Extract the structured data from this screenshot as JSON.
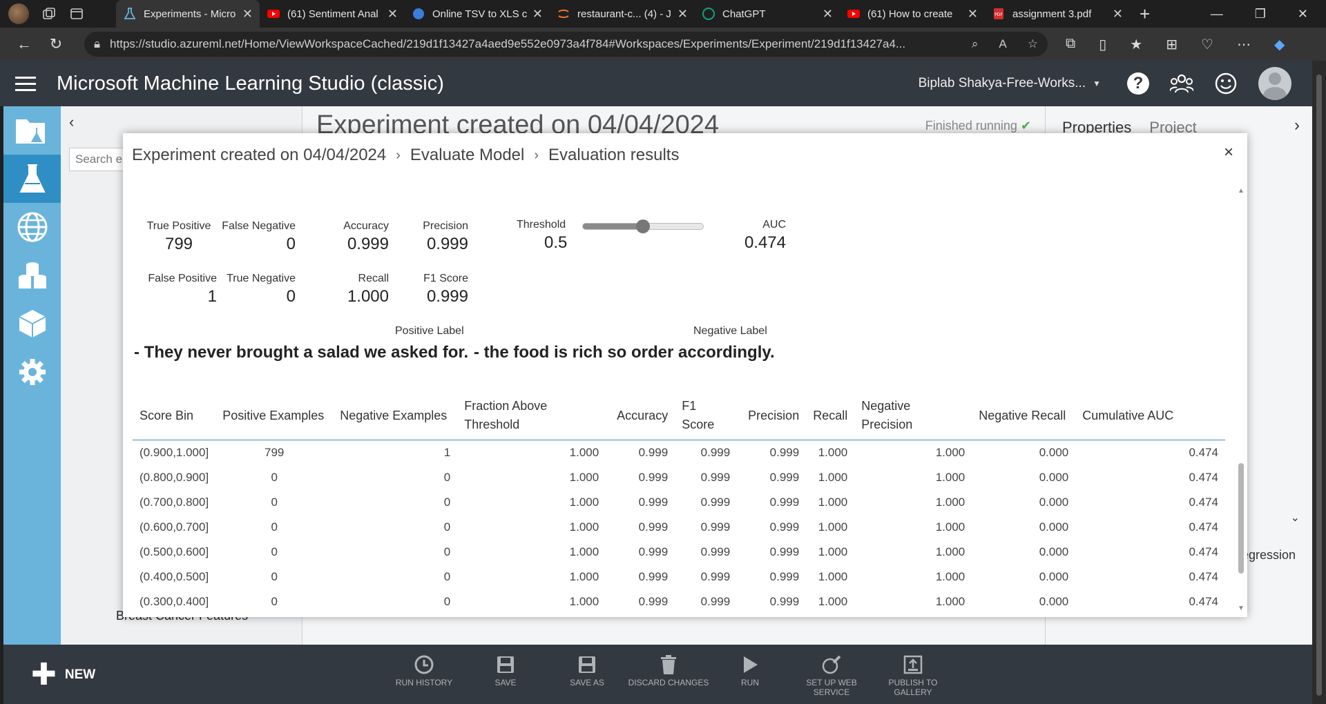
{
  "browser": {
    "tabs": [
      {
        "label": "Experiments - Micro",
        "active": true
      },
      {
        "label": "(61) Sentiment Anal"
      },
      {
        "label": "Online TSV to XLS c"
      },
      {
        "label": "restaurant-c... (4) - J"
      },
      {
        "label": "ChatGPT"
      },
      {
        "label": "(61) How to create"
      },
      {
        "label": "assignment 3.pdf"
      }
    ],
    "url": "https://studio.azureml.net/Home/ViewWorkspaceCached/219d1f13427a4aed9e552e0973a4f784#Workspaces/Experiments/Experiment/219d1f13427a4..."
  },
  "studio": {
    "title": "Microsoft Machine Learning Studio (classic)",
    "workspace": "Biplab Shakya-Free-Works...",
    "help": "?"
  },
  "palette": {
    "search_placeholder": "Search e",
    "bottom_item": "Breast Cancer Features"
  },
  "canvas": {
    "title": "Experiment created on 04/04/2024",
    "status": "Finished running"
  },
  "properties": {
    "tab_properties": "Properties",
    "tab_project": "Project",
    "fragment": "regression"
  },
  "modal": {
    "breadcrumb": [
      "Experiment created on 04/04/2024",
      "Evaluate Model",
      "Evaluation results"
    ],
    "metrics": {
      "true_positive": {
        "label": "True Positive",
        "value": "799"
      },
      "false_negative": {
        "label": "False Negative",
        "value": "0"
      },
      "accuracy": {
        "label": "Accuracy",
        "value": "0.999"
      },
      "precision": {
        "label": "Precision",
        "value": "0.999"
      },
      "false_positive": {
        "label": "False Positive",
        "value": "1"
      },
      "true_negative": {
        "label": "True Negative",
        "value": "0"
      },
      "recall": {
        "label": "Recall",
        "value": "1.000"
      },
      "f1": {
        "label": "F1 Score",
        "value": "0.999"
      },
      "threshold": {
        "label": "Threshold",
        "value": "0.5"
      },
      "auc": {
        "label": "AUC",
        "value": "0.474"
      }
    },
    "threshold_fraction": 0.5,
    "positive_label": {
      "label": "Positive Label",
      "value": "- They never brought a salad we asked for."
    },
    "negative_label": {
      "label": "Negative Label",
      "value": "- the food is rich so order accordingly."
    },
    "table": {
      "headers": [
        "Score Bin",
        "Positive Examples",
        "Negative Examples",
        "Fraction Above Threshold",
        "Accuracy",
        "F1 Score",
        "Precision",
        "Recall",
        "Negative Precision",
        "Negative Recall",
        "Cumulative AUC"
      ],
      "rows": [
        [
          "(0.900,1.000]",
          "799",
          "1",
          "1.000",
          "0.999",
          "0.999",
          "0.999",
          "1.000",
          "1.000",
          "0.000",
          "0.474"
        ],
        [
          "(0.800,0.900]",
          "0",
          "0",
          "1.000",
          "0.999",
          "0.999",
          "0.999",
          "1.000",
          "1.000",
          "0.000",
          "0.474"
        ],
        [
          "(0.700,0.800]",
          "0",
          "0",
          "1.000",
          "0.999",
          "0.999",
          "0.999",
          "1.000",
          "1.000",
          "0.000",
          "0.474"
        ],
        [
          "(0.600,0.700]",
          "0",
          "0",
          "1.000",
          "0.999",
          "0.999",
          "0.999",
          "1.000",
          "1.000",
          "0.000",
          "0.474"
        ],
        [
          "(0.500,0.600]",
          "0",
          "0",
          "1.000",
          "0.999",
          "0.999",
          "0.999",
          "1.000",
          "1.000",
          "0.000",
          "0.474"
        ],
        [
          "(0.400,0.500]",
          "0",
          "0",
          "1.000",
          "0.999",
          "0.999",
          "0.999",
          "1.000",
          "1.000",
          "0.000",
          "0.474"
        ],
        [
          "(0.300,0.400]",
          "0",
          "0",
          "1.000",
          "0.999",
          "0.999",
          "0.999",
          "1.000",
          "1.000",
          "0.000",
          "0.474"
        ]
      ]
    }
  },
  "toolbar": {
    "new_label": "NEW",
    "items": [
      "RUN HISTORY",
      "SAVE",
      "SAVE AS",
      "DISCARD CHANGES",
      "RUN",
      "SET UP WEB SERVICE",
      "PUBLISH TO GALLERY"
    ]
  },
  "colors": {
    "nav_blue": "#6ab4dc",
    "nav_selected": "#2f8fc4",
    "header": "#333940",
    "check_green": "#4caf50"
  }
}
